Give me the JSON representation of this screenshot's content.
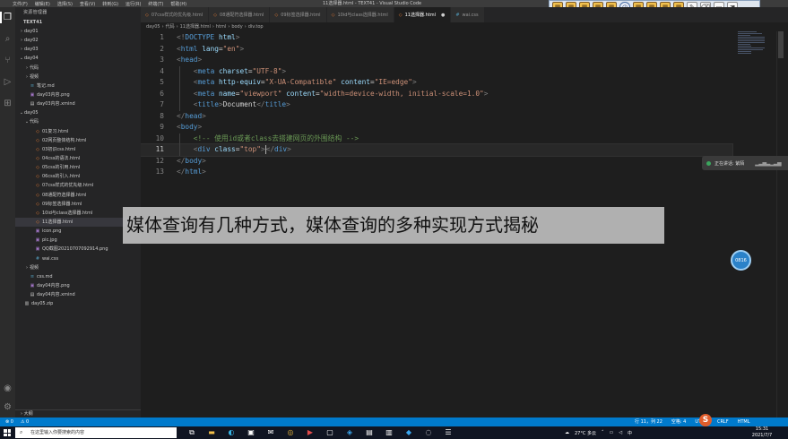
{
  "titlebar": {
    "menu": [
      "文件(F)",
      "编辑(E)",
      "选择(S)",
      "查看(V)",
      "转到(G)",
      "运行(R)",
      "终端(T)",
      "帮助(H)"
    ],
    "window_title": "11选择器.html - TEXT41 - Visual Studio Code"
  },
  "explorer": {
    "header": "资源管理器",
    "root": "TEXT41",
    "items": [
      {
        "label": "day01",
        "depth": 1,
        "kind": "folder",
        "open": false
      },
      {
        "label": "day02",
        "depth": 1,
        "kind": "folder",
        "open": false
      },
      {
        "label": "day03",
        "depth": 1,
        "kind": "folder",
        "open": false
      },
      {
        "label": "day04",
        "depth": 1,
        "kind": "folder",
        "open": true
      },
      {
        "label": "代码",
        "depth": 2,
        "kind": "folder",
        "open": false
      },
      {
        "label": "视频",
        "depth": 2,
        "kind": "folder",
        "open": false
      },
      {
        "label": "笔记.md",
        "depth": 2,
        "kind": "md"
      },
      {
        "label": "day03内容.png",
        "depth": 2,
        "kind": "img"
      },
      {
        "label": "day03内容.xmind",
        "depth": 2,
        "kind": "xmind"
      },
      {
        "label": "day05",
        "depth": 1,
        "kind": "folder",
        "open": true
      },
      {
        "label": "代码",
        "depth": 2,
        "kind": "folder",
        "open": true
      },
      {
        "label": "01复习.html",
        "depth": 3,
        "kind": "html"
      },
      {
        "label": "02网页整体结构.html",
        "depth": 3,
        "kind": "html"
      },
      {
        "label": "03初识css.html",
        "depth": 3,
        "kind": "html"
      },
      {
        "label": "04css的语法.html",
        "depth": 3,
        "kind": "html"
      },
      {
        "label": "05css的引用.html",
        "depth": 3,
        "kind": "html"
      },
      {
        "label": "06css的引入.html",
        "depth": 3,
        "kind": "html"
      },
      {
        "label": "07css样式的优先级.html",
        "depth": 3,
        "kind": "html"
      },
      {
        "label": "08通配符选择器.html",
        "depth": 3,
        "kind": "html"
      },
      {
        "label": "09标签选择器.html",
        "depth": 3,
        "kind": "html"
      },
      {
        "label": "10id与class选择器.html",
        "depth": 3,
        "kind": "html"
      },
      {
        "label": "11选择器.html",
        "depth": 3,
        "kind": "html",
        "selected": true
      },
      {
        "label": "icon.png",
        "depth": 3,
        "kind": "img"
      },
      {
        "label": "pic.jpg",
        "depth": 3,
        "kind": "img"
      },
      {
        "label": "QQ截图20210707092914.png",
        "depth": 3,
        "kind": "img"
      },
      {
        "label": "wai.css",
        "depth": 3,
        "kind": "css"
      },
      {
        "label": "视频",
        "depth": 2,
        "kind": "folder",
        "open": false
      },
      {
        "label": "css.md",
        "depth": 2,
        "kind": "md"
      },
      {
        "label": "day04内容.png",
        "depth": 2,
        "kind": "img"
      },
      {
        "label": "day04内容.xmind",
        "depth": 2,
        "kind": "xmind"
      },
      {
        "label": "day05.zip",
        "depth": 1,
        "kind": "zip"
      }
    ],
    "outline_label": "大纲"
  },
  "tabs": [
    {
      "label": "07css样式的优先级.html",
      "active": false
    },
    {
      "label": "08通配符选择器.html",
      "active": false
    },
    {
      "label": "09标签选择器.html",
      "active": false
    },
    {
      "label": "10id与class选择器.html",
      "active": false
    },
    {
      "label": "11选择器.html",
      "active": true
    },
    {
      "label": "wai.css",
      "active": false,
      "icon": "#"
    }
  ],
  "breadcrumb": [
    "day05",
    "代码",
    "11选择器.html",
    "html",
    "body",
    "div.top"
  ],
  "code": {
    "current_line": 11,
    "lines": [
      [
        [
          "br",
          "<!"
        ],
        [
          "tag",
          "DOCTYPE"
        ],
        [
          "txt",
          " "
        ],
        [
          "attr",
          "html"
        ],
        [
          "br",
          ">"
        ]
      ],
      [
        [
          "br",
          "<"
        ],
        [
          "tag",
          "html"
        ],
        [
          "txt",
          " "
        ],
        [
          "attr",
          "lang"
        ],
        [
          "txt",
          "="
        ],
        [
          "str",
          "\"en\""
        ],
        [
          "br",
          ">"
        ]
      ],
      [
        [
          "br",
          "<"
        ],
        [
          "tag",
          "head"
        ],
        [
          "br",
          ">"
        ]
      ],
      [
        [
          "txt",
          "    "
        ],
        [
          "br",
          "<"
        ],
        [
          "tag",
          "meta"
        ],
        [
          "txt",
          " "
        ],
        [
          "attr",
          "charset"
        ],
        [
          "txt",
          "="
        ],
        [
          "str",
          "\"UTF-8\""
        ],
        [
          "br",
          ">"
        ]
      ],
      [
        [
          "txt",
          "    "
        ],
        [
          "br",
          "<"
        ],
        [
          "tag",
          "meta"
        ],
        [
          "txt",
          " "
        ],
        [
          "attr",
          "http-equiv"
        ],
        [
          "txt",
          "="
        ],
        [
          "str",
          "\"X-UA-Compatible\""
        ],
        [
          "txt",
          " "
        ],
        [
          "attr",
          "content"
        ],
        [
          "txt",
          "="
        ],
        [
          "str",
          "\"IE=edge\""
        ],
        [
          "br",
          ">"
        ]
      ],
      [
        [
          "txt",
          "    "
        ],
        [
          "br",
          "<"
        ],
        [
          "tag",
          "meta"
        ],
        [
          "txt",
          " "
        ],
        [
          "attr",
          "name"
        ],
        [
          "txt",
          "="
        ],
        [
          "str",
          "\"viewport\""
        ],
        [
          "txt",
          " "
        ],
        [
          "attr",
          "content"
        ],
        [
          "txt",
          "="
        ],
        [
          "str",
          "\"width=device-width, initial-scale=1.0\""
        ],
        [
          "br",
          ">"
        ]
      ],
      [
        [
          "txt",
          "    "
        ],
        [
          "br",
          "<"
        ],
        [
          "tag",
          "title"
        ],
        [
          "br",
          ">"
        ],
        [
          "txt",
          "Document"
        ],
        [
          "br",
          "</"
        ],
        [
          "tag",
          "title"
        ],
        [
          "br",
          ">"
        ]
      ],
      [
        [
          "br",
          "</"
        ],
        [
          "tag",
          "head"
        ],
        [
          "br",
          ">"
        ]
      ],
      [
        [
          "br",
          "<"
        ],
        [
          "tag",
          "body"
        ],
        [
          "br",
          ">"
        ]
      ],
      [
        [
          "txt",
          "    "
        ],
        [
          "cmt",
          "<!-- 使用id或者class去搭建网页的外围结构 -->"
        ]
      ],
      [
        [
          "txt",
          "    "
        ],
        [
          "br",
          "<"
        ],
        [
          "tag",
          "div"
        ],
        [
          "txt",
          " "
        ],
        [
          "attr",
          "class"
        ],
        [
          "txt",
          "="
        ],
        [
          "str",
          "\"top\""
        ],
        [
          "br",
          ">"
        ],
        [
          "cursor",
          ""
        ],
        [
          "br",
          "</"
        ],
        [
          "tag",
          "div"
        ],
        [
          "br",
          ">"
        ]
      ],
      [
        [
          "br",
          "</"
        ],
        [
          "tag",
          "body"
        ],
        [
          "br",
          ">"
        ]
      ],
      [
        [
          "br",
          "</"
        ],
        [
          "tag",
          "html"
        ],
        [
          "br",
          ">"
        ]
      ]
    ]
  },
  "toast": {
    "text": "正在讲话: 紫陌"
  },
  "bubble": {
    "text": "0816"
  },
  "caption": "媒体查询有几种方式，媒体查询的多种实现方式揭秘",
  "statusbar": {
    "left": [
      "⊗ 0",
      "⚠ 0"
    ],
    "right": [
      "行 11，列 22",
      "空格: 4",
      "UTF-8",
      "CRLF",
      "HTML"
    ]
  },
  "taskbar": {
    "search_placeholder": "在这里输入你要搜索的内容",
    "weather": "27°C 多云",
    "time": "15:31",
    "date": "2021/7/7"
  },
  "colors": {
    "accent": "#007acc",
    "editor_bg": "#1e1e1e",
    "sidebar_bg": "#252526"
  }
}
